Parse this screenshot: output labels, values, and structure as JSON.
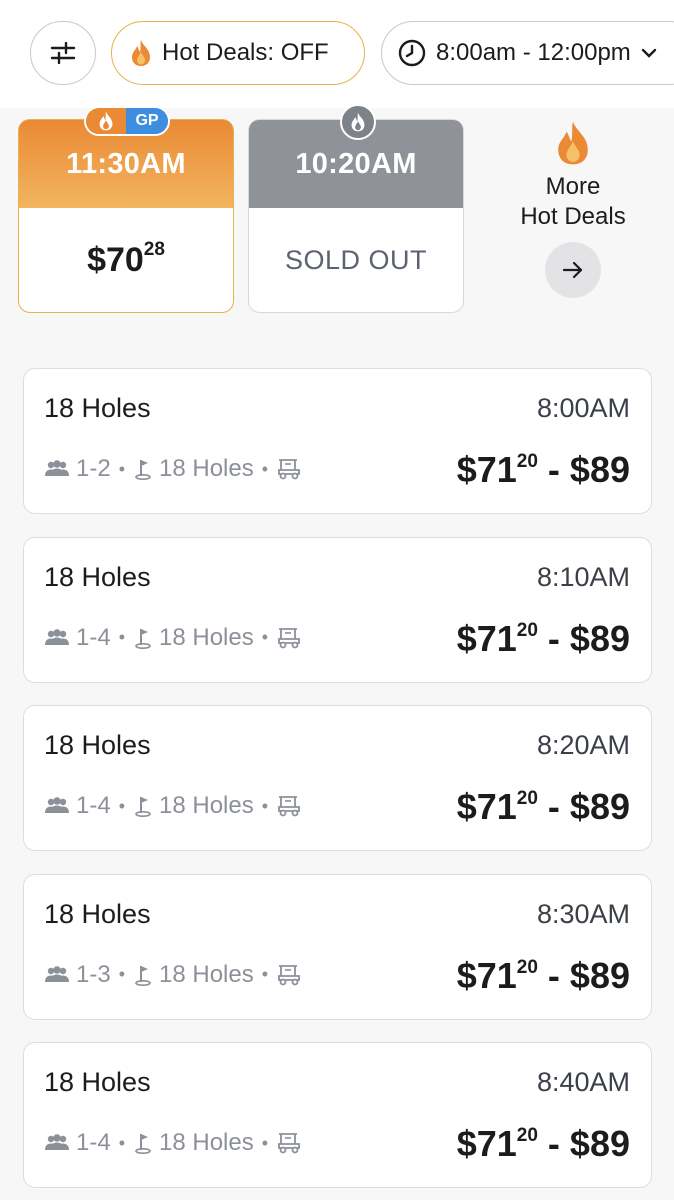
{
  "filters": {
    "hot_deals_label": "Hot Deals: OFF",
    "time_range_label": "8:00am - 12:00pm",
    "icons": {
      "settings": "sliders-icon",
      "hot": "flame-icon",
      "time": "clock-icon",
      "dropdown": "chevron-down-icon"
    }
  },
  "featured": [
    {
      "time": "11:30AM",
      "price_dollars": "$70",
      "price_cents": "28",
      "badge": "GP",
      "status": "available"
    },
    {
      "time": "10:20AM",
      "status_text": "SOLD OUT",
      "status": "sold_out"
    }
  ],
  "more_deals": {
    "line1": "More",
    "line2": "Hot Deals"
  },
  "tee_times": [
    {
      "title": "18 Holes",
      "time": "8:00AM",
      "players": "1-2",
      "holes": "18 Holes",
      "price_low_dollars": "$71",
      "price_low_cents": "20",
      "price_high": "$89"
    },
    {
      "title": "18 Holes",
      "time": "8:10AM",
      "players": "1-4",
      "holes": "18 Holes",
      "price_low_dollars": "$71",
      "price_low_cents": "20",
      "price_high": "$89"
    },
    {
      "title": "18 Holes",
      "time": "8:20AM",
      "players": "1-4",
      "holes": "18 Holes",
      "price_low_dollars": "$71",
      "price_low_cents": "20",
      "price_high": "$89"
    },
    {
      "title": "18 Holes",
      "time": "8:30AM",
      "players": "1-3",
      "holes": "18 Holes",
      "price_low_dollars": "$71",
      "price_low_cents": "20",
      "price_high": "$89"
    },
    {
      "title": "18 Holes",
      "time": "8:40AM",
      "players": "1-4",
      "holes": "18 Holes",
      "price_low_dollars": "$71",
      "price_low_cents": "20",
      "price_high": "$89"
    }
  ],
  "colors": {
    "accent_orange": "#ea8a35",
    "gp_blue": "#3d8de0",
    "sold_gray": "#8f9399"
  }
}
